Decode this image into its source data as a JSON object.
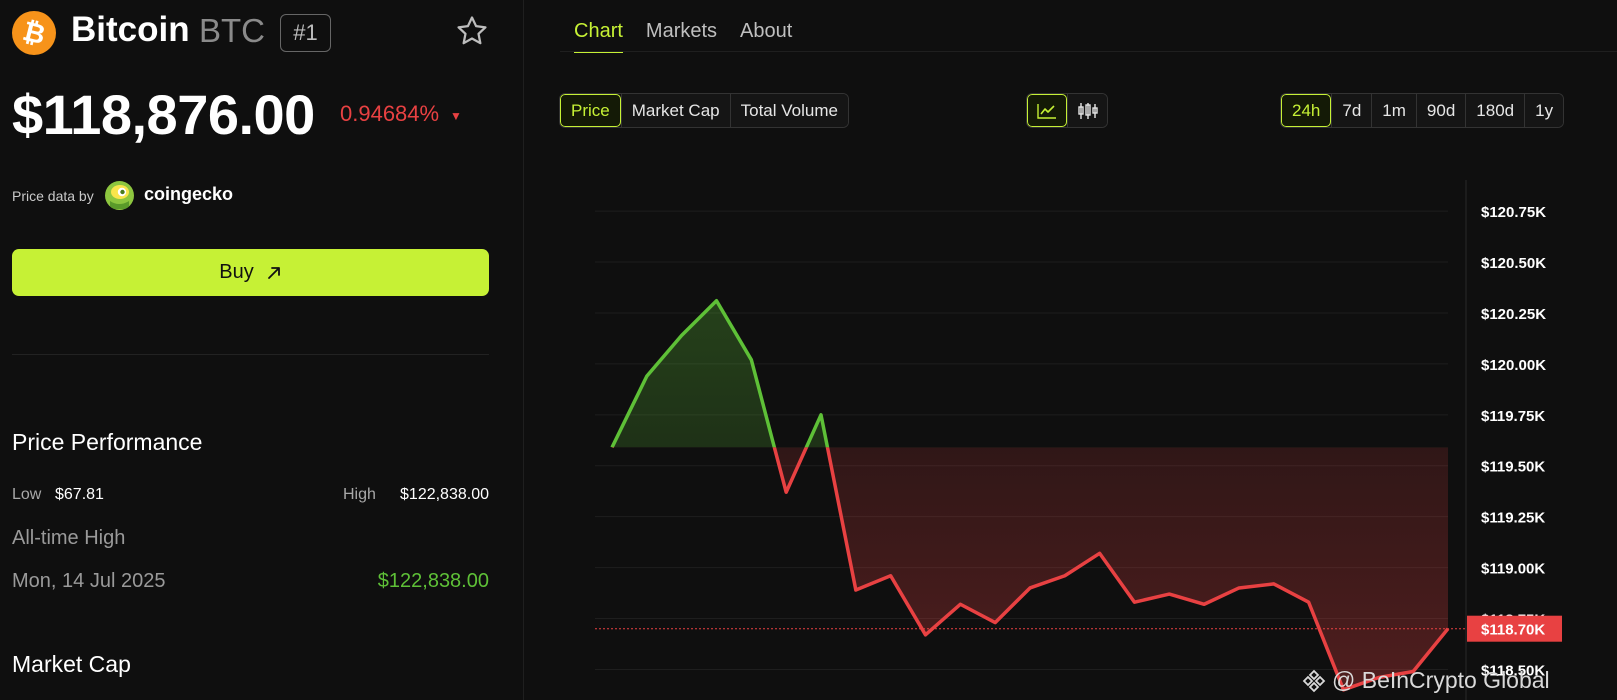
{
  "coin": {
    "name": "Bitcoin",
    "symbol": "BTC",
    "rank": "#1",
    "logo_glyph": "₿",
    "price": "$118,876.00",
    "change": "0.94684%",
    "change_direction": "down",
    "change_arrow": "▼",
    "favorite_icon": "star-icon"
  },
  "source": {
    "label": "Price data by",
    "provider": "coingecko"
  },
  "buy": {
    "label": "Buy",
    "icon": "arrow-up-right-icon",
    "color": "#c6f135"
  },
  "performance": {
    "title": "Price Performance",
    "low_label": "Low",
    "low_value": "$67.81",
    "high_label": "High",
    "high_value": "$122,838.00",
    "ath_label": "All-time High",
    "ath_date": "Mon, 14 Jul 2025",
    "ath_value": "$122,838.00"
  },
  "market_cap": {
    "title": "Market Cap"
  },
  "tabs": [
    {
      "label": "Chart",
      "active": true
    },
    {
      "label": "Markets",
      "active": false
    },
    {
      "label": "About",
      "active": false
    }
  ],
  "metric_options": [
    {
      "label": "Price",
      "active": true
    },
    {
      "label": "Market Cap",
      "active": false
    },
    {
      "label": "Total Volume",
      "active": false
    }
  ],
  "view_options": [
    {
      "icon": "line-chart-icon",
      "active": true
    },
    {
      "icon": "candlestick-icon",
      "active": false
    }
  ],
  "range_options": [
    {
      "label": "24h",
      "active": true
    },
    {
      "label": "7d",
      "active": false
    },
    {
      "label": "1m",
      "active": false
    },
    {
      "label": "90d",
      "active": false
    },
    {
      "label": "180d",
      "active": false
    },
    {
      "label": "1y",
      "active": false
    }
  ],
  "colors": {
    "accent": "#c6f135",
    "up": "#5ec037",
    "down": "#e84142",
    "bitcoin": "#f7931a"
  },
  "chart_data": {
    "type": "line",
    "series": [
      {
        "values": [
          119.59,
          119.94,
          120.14,
          120.31,
          120.02,
          119.37,
          119.75,
          118.89,
          118.96,
          118.67,
          118.82,
          118.73,
          118.9,
          118.96,
          119.07,
          118.83,
          118.87,
          118.82,
          118.9,
          118.92,
          118.83,
          118.4,
          118.46,
          118.49,
          118.7
        ]
      }
    ],
    "baseline": 119.59,
    "current_value": 118.7,
    "current_label": "$118.70K",
    "y_ticks": [
      120.75,
      120.5,
      120.25,
      120.0,
      119.75,
      119.5,
      119.25,
      119.0,
      118.75,
      118.5
    ],
    "y_tick_labels": [
      "$120.75K",
      "$120.50K",
      "$120.25K",
      "$120.00K",
      "$119.75K",
      "$119.50K",
      "$119.25K",
      "$119.00K",
      "$118.75K",
      "$118.50K"
    ],
    "ylim": [
      118.35,
      121.05
    ],
    "grid": true
  },
  "watermark": "@ BeInCrypto Global"
}
